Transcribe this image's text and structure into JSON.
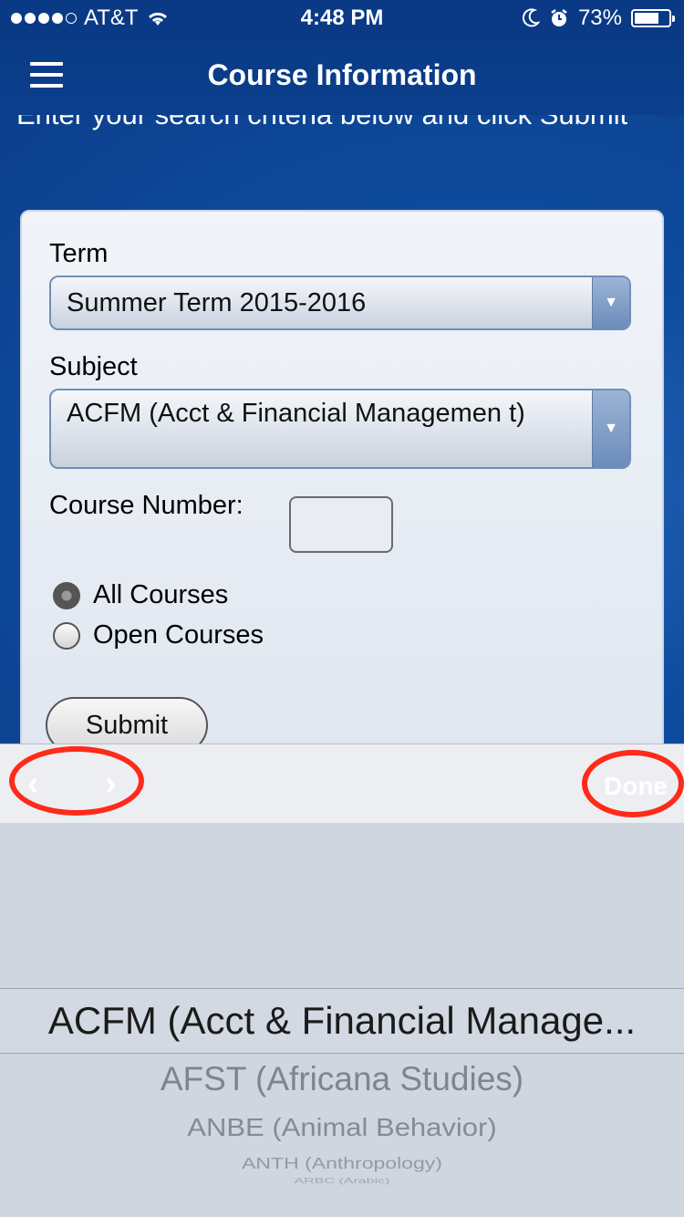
{
  "status_bar": {
    "carrier": "AT&T",
    "time": "4:48 PM",
    "battery": "73%",
    "battery_level": 0.73,
    "signal_bars_filled": 4,
    "icons": [
      "signal-dots-icon",
      "wifi-icon",
      "moon-icon",
      "alarm-icon",
      "battery-icon"
    ]
  },
  "nav": {
    "title": "Course Information",
    "menu_icon": "hamburger-menu-icon"
  },
  "intro": {
    "text": "Enter your search criteria below and click Submit"
  },
  "form": {
    "term_label": "Term",
    "term_value": "Summer Term 2015-2016",
    "subject_label": "Subject",
    "subject_value": "ACFM (Acct & Financial Managemen t)",
    "course_number_label": "Course Number:",
    "course_number_value": "",
    "radio_all": "All Courses",
    "radio_open": "Open Courses",
    "selected_radio": "All Courses",
    "submit_label": "Submit"
  },
  "toolbar": {
    "prev_icon": "‹",
    "next_icon": "›",
    "done_label": "Done",
    "annotation_color": "#ff2a1a"
  },
  "picker": {
    "options": [
      "ACFM (Acct & Financial Manage...",
      "AFST (Africana Studies)",
      "ANBE (Animal Behavior)",
      "ANTH (Anthropology)",
      "ARBC (Arabic)"
    ],
    "selected_index": 0
  }
}
